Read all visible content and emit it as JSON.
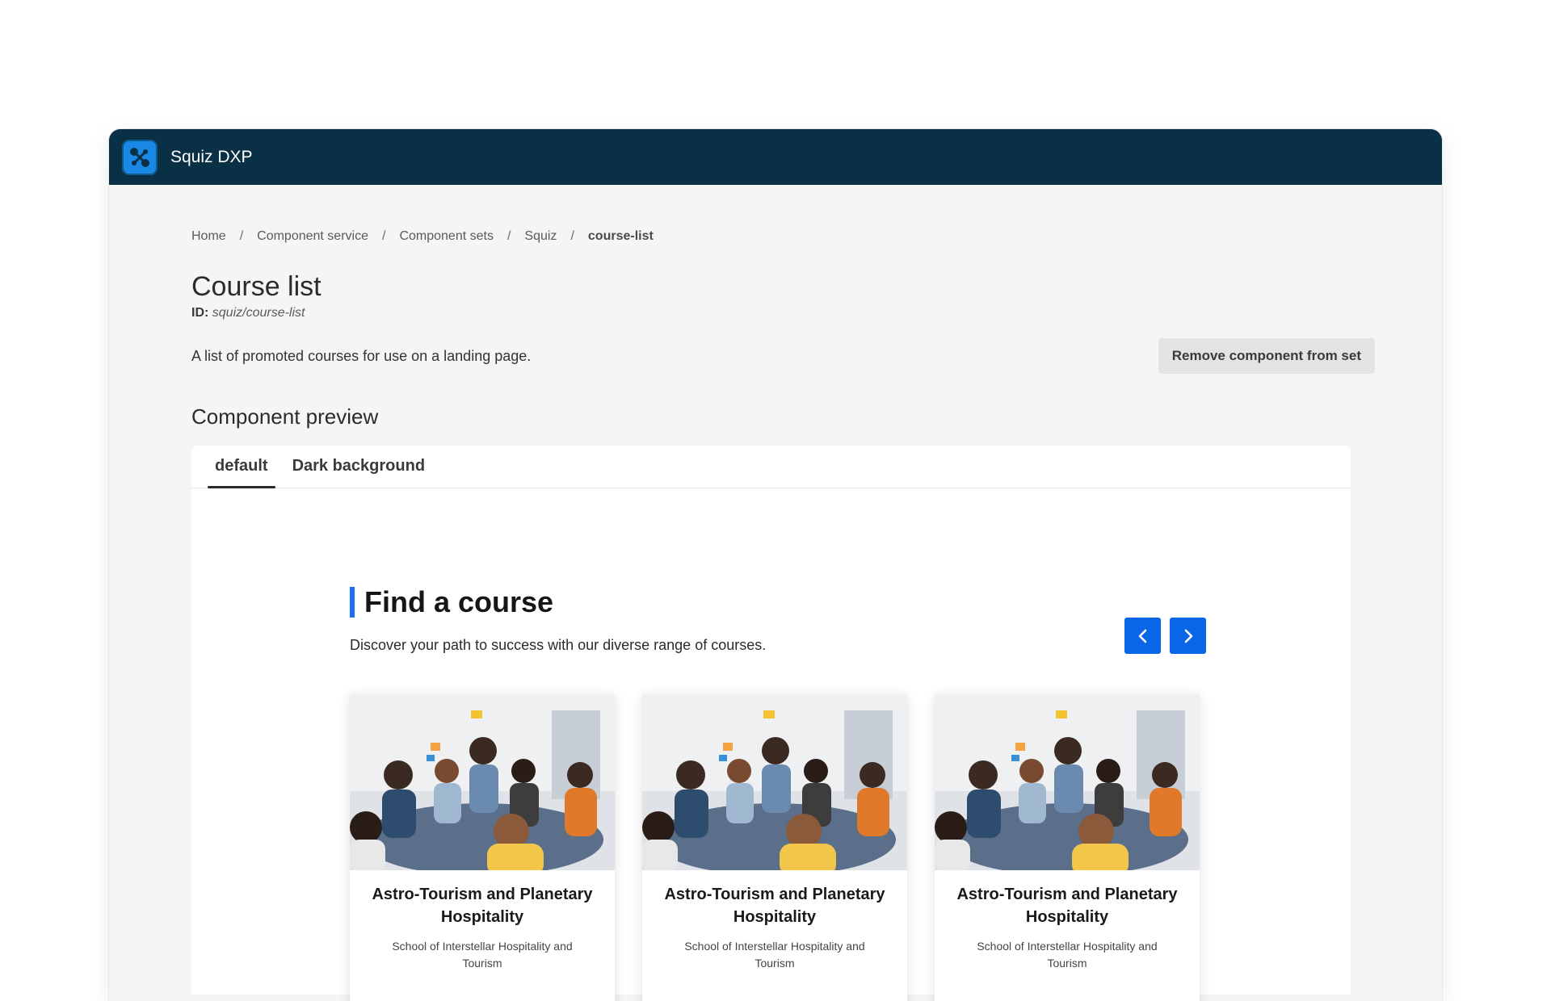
{
  "app": {
    "title": "Squiz DXP"
  },
  "breadcrumb": [
    "Home",
    "Component service",
    "Component sets",
    "Squiz",
    "course-list"
  ],
  "page": {
    "title": "Course list",
    "id_label": "ID:",
    "id_value": "squiz/course-list",
    "description": "A list of promoted courses for use on a landing page.",
    "remove_button": "Remove component from set"
  },
  "preview": {
    "heading": "Component preview",
    "tabs": [
      {
        "label": "default",
        "active": true
      },
      {
        "label": "Dark background",
        "active": false
      }
    ]
  },
  "widget": {
    "title": "Find a course",
    "subtitle": "Discover your path to success with our diverse range of courses.",
    "accent_color": "#1a6ef5",
    "button_color": "#0a66e8",
    "prev_icon": "chevron-left-icon",
    "next_icon": "chevron-right-icon",
    "cards": [
      {
        "title": "Astro-Tourism and Planetary Hospitality",
        "school": "School of Interstellar Hospitality and Tourism"
      },
      {
        "title": "Astro-Tourism and Planetary Hospitality",
        "school": "School of Interstellar Hospitality and Tourism"
      },
      {
        "title": "Astro-Tourism and Planetary Hospitality",
        "school": "School of Interstellar Hospitality and Tourism"
      }
    ]
  },
  "colors": {
    "topbar": "#0a3046",
    "logo": "#1a88e6"
  }
}
